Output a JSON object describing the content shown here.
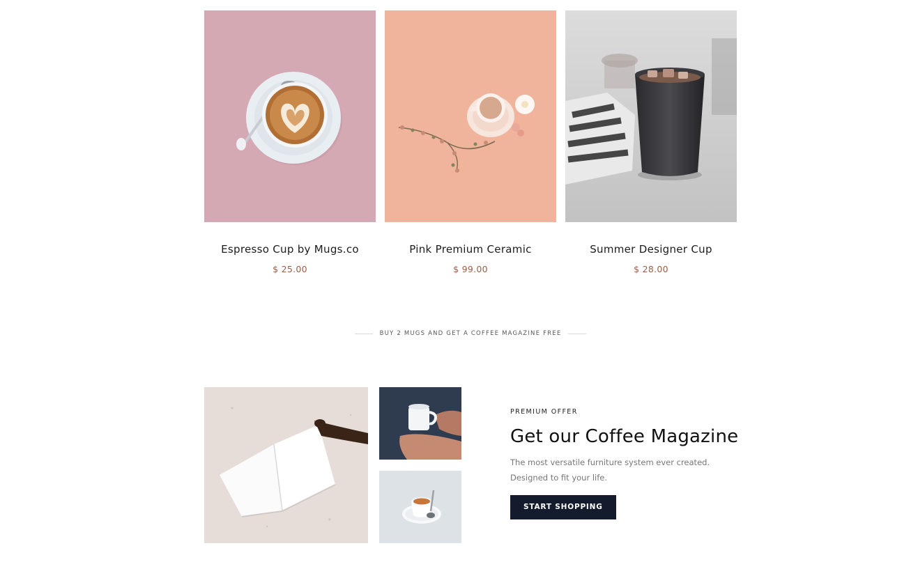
{
  "products": [
    {
      "name": "Espresso Cup by Mugs.co",
      "price": "$ 25.00",
      "image_icon": "latte-cup-image"
    },
    {
      "name": "Pink Premium Ceramic",
      "price": "$ 99.00",
      "image_icon": "flower-cup-image"
    },
    {
      "name": "Summer Designer Cup",
      "price": "$ 28.00",
      "image_icon": "iced-coffee-cup-image"
    }
  ],
  "promo_banner": {
    "text": "BUY 2 MUGS AND GET A COFFEE MAGAZINE FREE"
  },
  "offer": {
    "eyebrow": "PREMIUM OFFER",
    "title": "Get our Coffee Magazine",
    "description_line1": "The most versatile furniture system ever created.",
    "description_line2": "Designed to fit your life.",
    "button_label": "START SHOPPING"
  },
  "colors": {
    "price": "#9b5d45",
    "button_bg": "#141b2d",
    "product1_bg": "#d4a9b4",
    "product2_bg": "#f0b49c",
    "product3_bg": "#cfcfcf"
  }
}
